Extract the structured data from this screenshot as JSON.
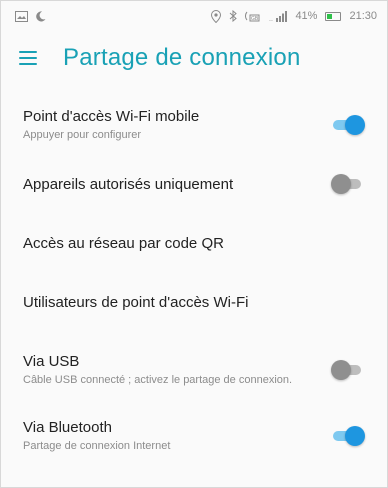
{
  "status_bar": {
    "battery_percent": "41%",
    "battery_level": 0.41,
    "time": "21:30",
    "icons": [
      "gallery-icon",
      "moon-icon",
      "location-icon",
      "bluetooth-icon",
      "hotspot-icon",
      "signal-icon"
    ]
  },
  "app_bar": {
    "title": "Partage de connexion",
    "menu_icon": "menu-icon",
    "accent_color": "#19a1b5"
  },
  "settings": [
    {
      "title": "Point d'accès Wi-Fi mobile",
      "subtitle": "Appuyer pour configurer",
      "toggle": true,
      "enabled": true
    },
    {
      "title": "Appareils autorisés uniquement",
      "subtitle": "",
      "toggle": true,
      "enabled": false
    },
    {
      "title": "Accès au réseau par code QR",
      "subtitle": "",
      "toggle": false
    },
    {
      "title": "Utilisateurs de point d'accès Wi-Fi",
      "subtitle": "",
      "toggle": false
    },
    {
      "title": "Via USB",
      "subtitle": "Câble USB connecté ; activez le partage de connexion.",
      "toggle": true,
      "enabled": false
    },
    {
      "title": "Via Bluetooth",
      "subtitle": "Partage de connexion Internet",
      "toggle": true,
      "enabled": true
    }
  ],
  "colors": {
    "toggle_on_thumb": "#1e96e0",
    "toggle_on_track": "#7ec9f0",
    "toggle_off_thumb": "#8f8f8f",
    "toggle_off_track": "#bdbdbd"
  }
}
